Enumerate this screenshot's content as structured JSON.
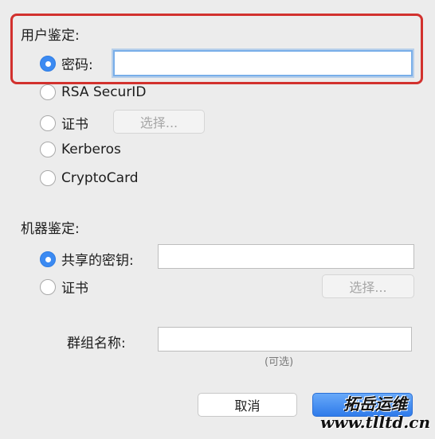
{
  "user_auth": {
    "label": "用户鉴定:",
    "options": [
      {
        "label": "密码:",
        "checked": true
      },
      {
        "label": "RSA SecurID",
        "checked": false
      },
      {
        "label": "证书",
        "checked": false
      },
      {
        "label": "Kerberos",
        "checked": false
      },
      {
        "label": "CryptoCard",
        "checked": false
      }
    ],
    "password_value": "",
    "certificate_button": "选择..."
  },
  "machine_auth": {
    "label": "机器鉴定:",
    "options": [
      {
        "label": "共享的密钥:",
        "checked": true
      },
      {
        "label": "证书",
        "checked": false
      }
    ],
    "shared_secret_value": "",
    "certificate_button": "选择..."
  },
  "group_name": {
    "label": "群组名称:",
    "value": "",
    "hint": "(可选)"
  },
  "buttons": {
    "cancel": "取消",
    "ok": "好"
  },
  "watermark": {
    "line1": "拓岳运维",
    "line2": "www.tlltd.cn"
  },
  "colors": {
    "accent": "#3b8af2",
    "highlight": "#d2312e",
    "background": "#ececec"
  }
}
